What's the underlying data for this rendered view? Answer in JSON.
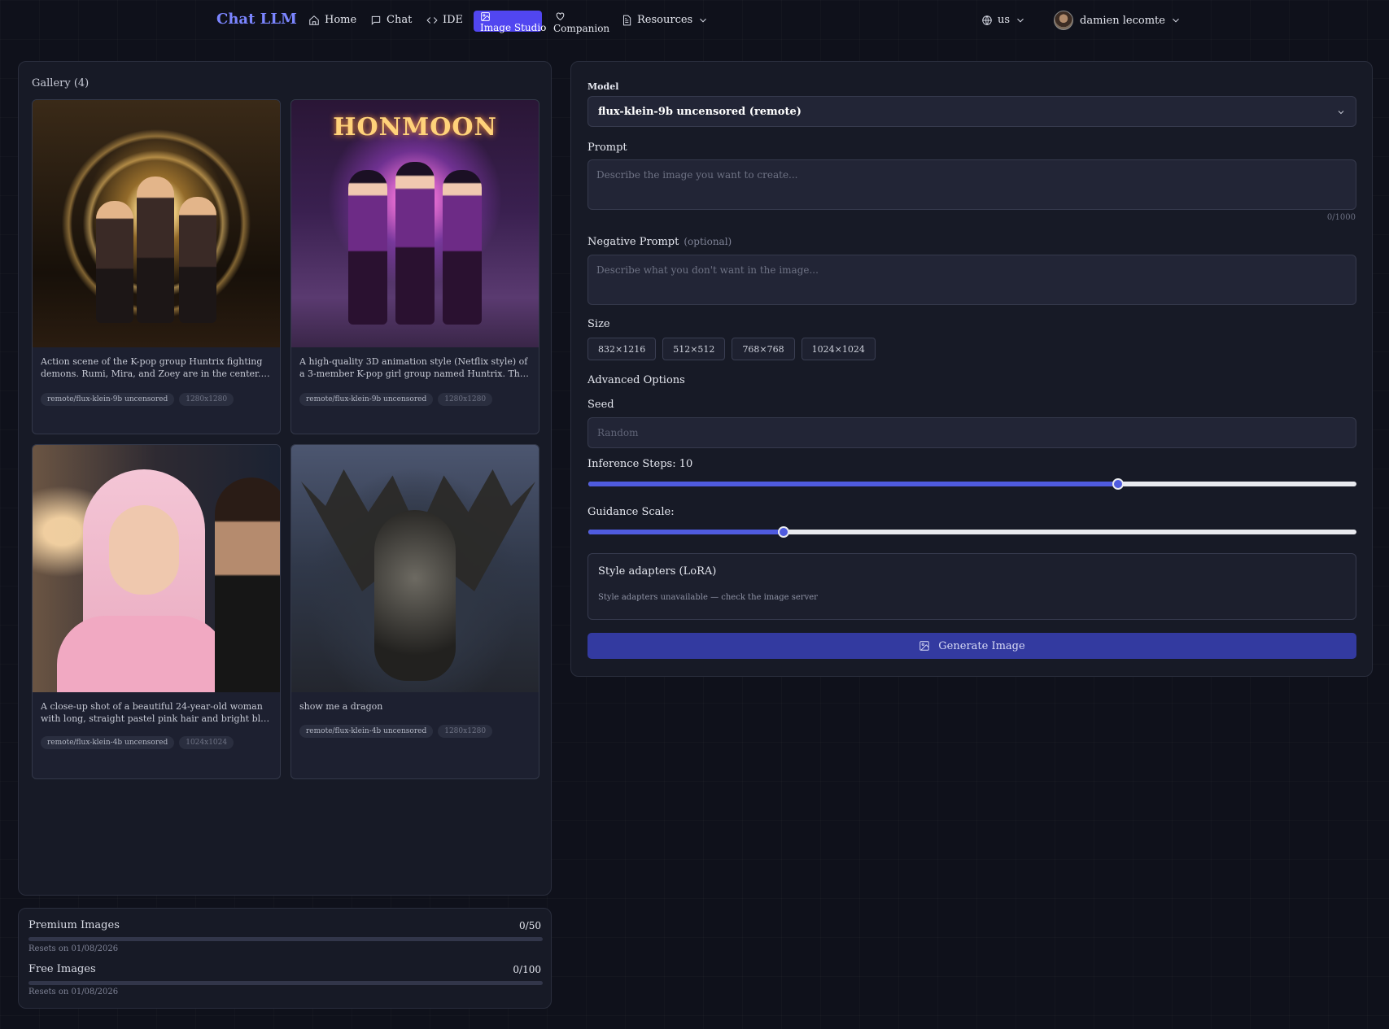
{
  "nav": {
    "brand": "Chat LLM",
    "items": [
      {
        "label": "Home",
        "icon": "home-icon"
      },
      {
        "label": "Chat",
        "icon": "chat-icon"
      },
      {
        "label": "IDE",
        "icon": "code-icon"
      },
      {
        "label": "Image Studio",
        "icon": "image-icon",
        "active": true
      },
      {
        "label": "Companion",
        "icon": "heart-icon"
      },
      {
        "label": "Resources",
        "icon": "document-icon"
      }
    ],
    "language": "us",
    "user": "damien lecomte"
  },
  "gallery": {
    "title": "Gallery (4)",
    "cards": [
      {
        "description": "Action scene of the K-pop group Huntrix fighting demons. Rumi, Mira, and Zoey are in the center. They are performin…",
        "model": "remote/flux-klein-9b uncensored",
        "size": "1280x1280"
      },
      {
        "description": "A high-quality 3D animation style (Netflix style) of a 3-member K-pop girl group named Huntrix. The girls are Ru…",
        "model": "remote/flux-klein-9b uncensored",
        "size": "1280x1280",
        "image_text": "HONMOON"
      },
      {
        "description": "A close-up shot of a beautiful 24-year-old woman with long, straight pastel pink hair and bright blue eyes. She has a…",
        "model": "remote/flux-klein-4b uncensored",
        "size": "1024x1024"
      },
      {
        "description": "show me a dragon",
        "model": "remote/flux-klein-4b uncensored",
        "size": "1280x1280"
      }
    ]
  },
  "usage": {
    "premium_label": "Premium Images",
    "premium_value": "0/50",
    "premium_reset": "Resets on 01/08/2026",
    "free_label": "Free Images",
    "free_value": "0/100",
    "free_reset": "Resets on 01/08/2026"
  },
  "form": {
    "model_label": "Model",
    "model_value": "flux-klein-9b uncensored (remote)",
    "prompt_label": "Prompt",
    "prompt_placeholder": "Describe the image you want to create...",
    "prompt_counter": "0/1000",
    "negative_label": "Negative Prompt",
    "negative_optional": "(optional)",
    "negative_placeholder": "Describe what you don't want in the image...",
    "size_label": "Size",
    "sizes": [
      "832×1216",
      "512×512",
      "768×768",
      "1024×1024"
    ],
    "advanced_label": "Advanced Options",
    "seed_label": "Seed",
    "seed_placeholder": "Random",
    "steps_label": "Inference Steps: 10",
    "steps_fraction": 0.69,
    "guidance_label": "Guidance Scale:",
    "guidance_fraction": 0.254,
    "lora_title": "Style adapters (LoRA)",
    "lora_status": "Style adapters unavailable — check the image server",
    "generate_label": "Generate Image"
  },
  "colors": {
    "accent": "#5146f0",
    "brand": "#7b85ff",
    "background": "#0f111b",
    "panel": "#171a26",
    "generate": "#333aa0"
  }
}
